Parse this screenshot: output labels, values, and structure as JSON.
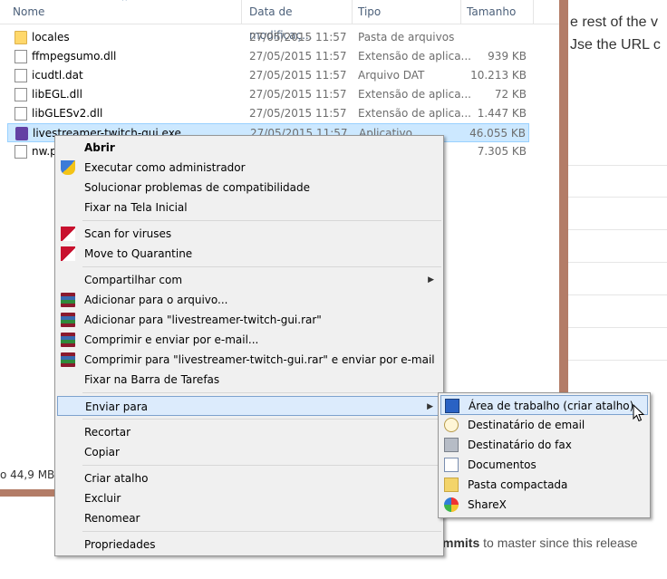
{
  "explorer": {
    "columns": {
      "name": "Nome",
      "date": "Data de modificaç...",
      "type": "Tipo",
      "size": "Tamanho"
    },
    "files": [
      {
        "name": "locales",
        "date": "27/05/2015 11:57",
        "type": "Pasta de arquivos",
        "size": "",
        "icon": "folder-icon"
      },
      {
        "name": "ffmpegsumo.dll",
        "date": "27/05/2015 11:57",
        "type": "Extensão de aplica...",
        "size": "939 KB",
        "icon": "dll-file-icon"
      },
      {
        "name": "icudtl.dat",
        "date": "27/05/2015 11:57",
        "type": "Arquivo DAT",
        "size": "10.213 KB",
        "icon": "file-icon"
      },
      {
        "name": "libEGL.dll",
        "date": "27/05/2015 11:57",
        "type": "Extensão de aplica...",
        "size": "72 KB",
        "icon": "dll-file-icon"
      },
      {
        "name": "libGLESv2.dll",
        "date": "27/05/2015 11:57",
        "type": "Extensão de aplica...",
        "size": "1.447 KB",
        "icon": "dll-file-icon"
      },
      {
        "name": "livestreamer-twitch-gui.exe",
        "date": "27/05/2015 11:57",
        "type": "Aplicativo",
        "size": "46.055 KB",
        "icon": "twitch-app-icon",
        "selected": true
      },
      {
        "name": "nw.p",
        "date": "",
        "type": "",
        "size": "7.305 KB",
        "icon": "file-icon"
      }
    ],
    "status": "o  44,9 MB"
  },
  "context_menu": {
    "groups": [
      [
        {
          "label": "Abrir",
          "bold": true,
          "icon": ""
        },
        {
          "label": "Executar como administrador",
          "icon": "uac-shield-icon"
        },
        {
          "label": "Solucionar problemas de compatibilidade",
          "icon": ""
        },
        {
          "label": "Fixar na Tela Inicial",
          "icon": ""
        }
      ],
      [
        {
          "label": "Scan for viruses",
          "icon": "kaspersky-icon"
        },
        {
          "label": "Move to Quarantine",
          "icon": "kaspersky-icon"
        }
      ],
      [
        {
          "label": "Compartilhar com",
          "icon": "",
          "submenu": true
        },
        {
          "label": "Adicionar para o arquivo...",
          "icon": "winrar-icon"
        },
        {
          "label": "Adicionar para \"livestreamer-twitch-gui.rar\"",
          "icon": "winrar-icon"
        },
        {
          "label": "Comprimir e enviar por e-mail...",
          "icon": "winrar-icon"
        },
        {
          "label": "Comprimir para \"livestreamer-twitch-gui.rar\" e enviar por e-mail",
          "icon": "winrar-icon"
        },
        {
          "label": "Fixar na Barra de Tarefas",
          "icon": ""
        }
      ],
      [
        {
          "label": "Enviar para",
          "icon": "",
          "submenu": true,
          "highlighted": true
        }
      ],
      [
        {
          "label": "Recortar",
          "icon": ""
        },
        {
          "label": "Copiar",
          "icon": ""
        }
      ],
      [
        {
          "label": "Criar atalho",
          "icon": ""
        },
        {
          "label": "Excluir",
          "icon": ""
        },
        {
          "label": "Renomear",
          "icon": ""
        }
      ],
      [
        {
          "label": "Propriedades",
          "icon": ""
        }
      ]
    ]
  },
  "send_to_menu": {
    "items": [
      {
        "label": "Área de trabalho (criar atalho)",
        "icon": "desktop-icon",
        "highlighted": true
      },
      {
        "label": "Destinatário de email",
        "icon": "mail-recipient-icon"
      },
      {
        "label": "Destinatário do fax",
        "icon": "fax-icon"
      },
      {
        "label": "Documentos",
        "icon": "documents-icon"
      },
      {
        "label": "Pasta compactada",
        "icon": "zip-folder-icon"
      },
      {
        "label": "ShareX",
        "icon": "sharex-icon"
      }
    ]
  },
  "background_page": {
    "line1": "e rest of the v",
    "line2": "Jse the URL c",
    "bottom_bold": "mmits",
    "bottom_rest": " to master since this release"
  }
}
